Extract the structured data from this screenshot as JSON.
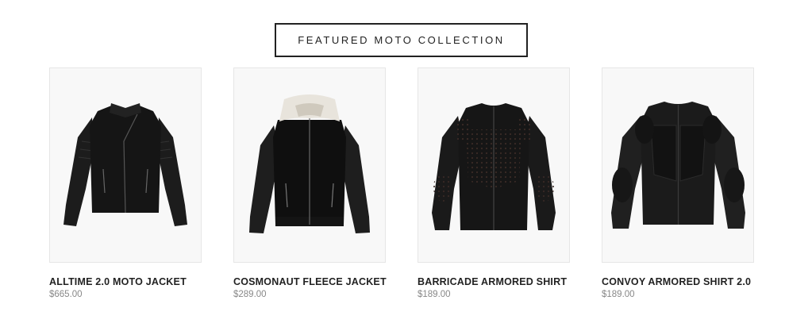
{
  "collection": {
    "button_label": "FEATURED MOTO COLLECTION"
  },
  "products": [
    {
      "title": "ALLTIME 2.0 MOTO JACKET",
      "price": "$665.00",
      "image": "leather-moto-jacket"
    },
    {
      "title": "COSMONAUT FLEECE JACKET",
      "price": "$289.00",
      "image": "shearling-collar-jacket"
    },
    {
      "title": "BARRICADE ARMORED SHIRT",
      "price": "$189.00",
      "image": "armored-shirt"
    },
    {
      "title": "CONVOY ARMORED SHIRT 2.0",
      "price": "$189.00",
      "image": "convoy-armored-shirt"
    }
  ],
  "colors": {
    "text": "#222222",
    "price": "#888888",
    "image_bg": "#f8f8f8",
    "jacket": "#1a1a1a",
    "fleece": "#e8e4dc"
  }
}
